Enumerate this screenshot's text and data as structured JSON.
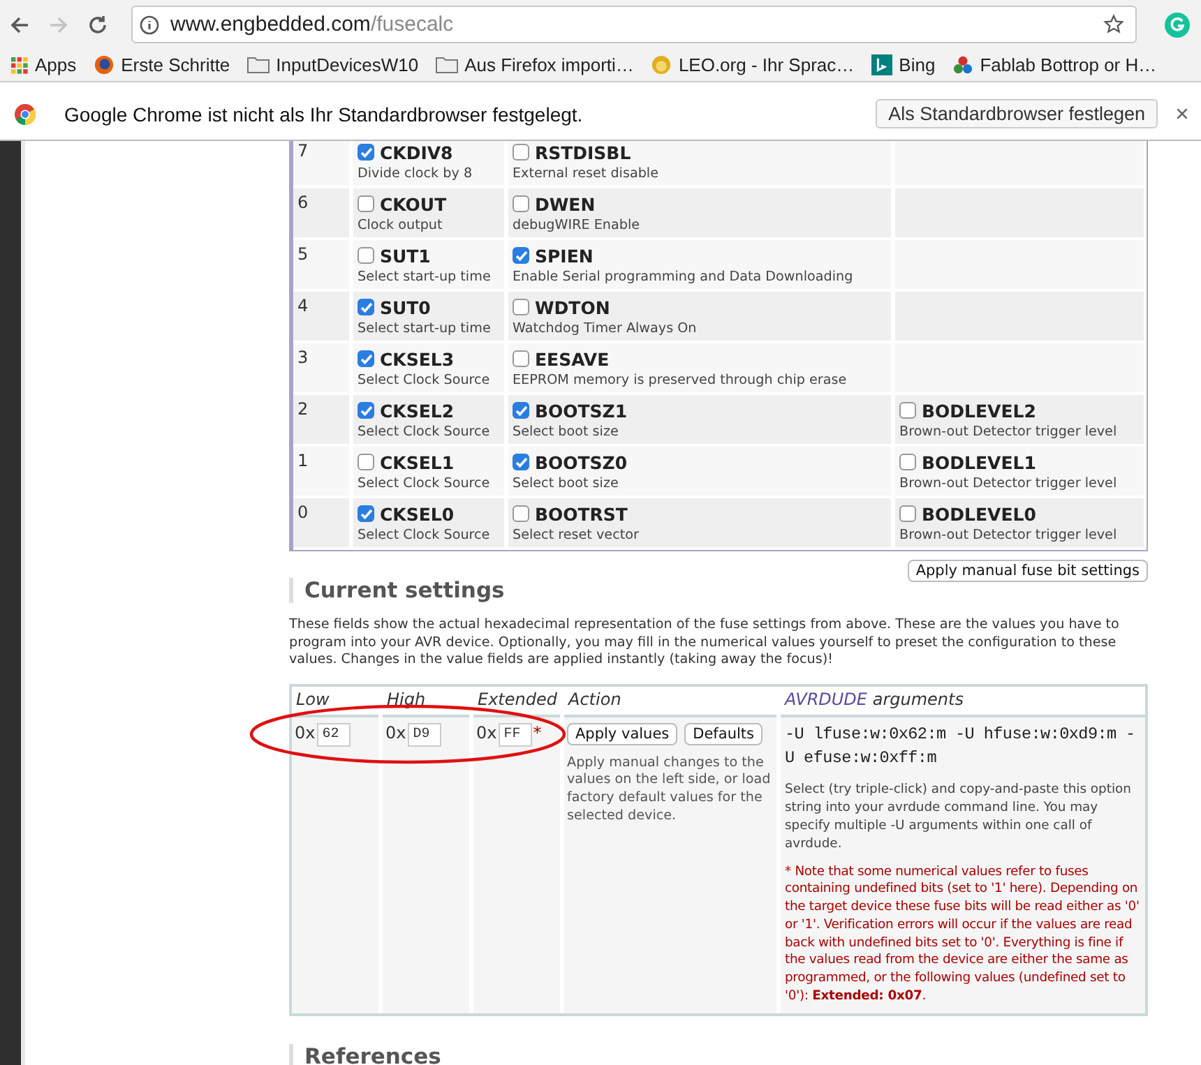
{
  "browser": {
    "url_host": "www.engbedded.com",
    "url_path": "/fusecalc",
    "bookmarks": [
      {
        "kind": "apps",
        "label": "Apps"
      },
      {
        "kind": "firefox",
        "label": "Erste Schritte"
      },
      {
        "kind": "folder",
        "label": "InputDevicesW10"
      },
      {
        "kind": "folder",
        "label": "Aus Firefox importi…"
      },
      {
        "kind": "leo",
        "label": "LEO.org - Ihr Sprac…"
      },
      {
        "kind": "bing",
        "label": "Bing"
      },
      {
        "kind": "fablab",
        "label": "Fablab Bottrop or H…"
      }
    ]
  },
  "infobar": {
    "message": "Google Chrome ist nicht als Ihr Standardbrowser festgelegt.",
    "button": "Als Standardbrowser festlegen"
  },
  "fuse_table": {
    "rows": [
      {
        "bit": "7",
        "fuses": [
          {
            "name": "CKDIV8",
            "checked": true,
            "description": "Divide clock by 8"
          },
          {
            "name": "RSTDISBL",
            "checked": false,
            "description": "External reset disable"
          }
        ]
      },
      {
        "bit": "6",
        "fuses": [
          {
            "name": "CKOUT",
            "checked": false,
            "description": "Clock output"
          },
          {
            "name": "DWEN",
            "checked": false,
            "description": "debugWIRE Enable"
          }
        ]
      },
      {
        "bit": "5",
        "fuses": [
          {
            "name": "SUT1",
            "checked": false,
            "description": "Select start-up time"
          },
          {
            "name": "SPIEN",
            "checked": true,
            "description": "Enable Serial programming and Data Downloading"
          }
        ]
      },
      {
        "bit": "4",
        "fuses": [
          {
            "name": "SUT0",
            "checked": true,
            "description": "Select start-up time"
          },
          {
            "name": "WDTON",
            "checked": false,
            "description": "Watchdog Timer Always On"
          }
        ]
      },
      {
        "bit": "3",
        "fuses": [
          {
            "name": "CKSEL3",
            "checked": true,
            "description": "Select Clock Source"
          },
          {
            "name": "EESAVE",
            "checked": false,
            "description": "EEPROM memory is preserved through chip erase"
          }
        ]
      },
      {
        "bit": "2",
        "fuses": [
          {
            "name": "CKSEL2",
            "checked": true,
            "description": "Select Clock Source"
          },
          {
            "name": "BOOTSZ1",
            "checked": true,
            "description": "Select boot size"
          },
          {
            "name": "BODLEVEL2",
            "checked": false,
            "description": "Brown-out Detector trigger level"
          }
        ]
      },
      {
        "bit": "1",
        "fuses": [
          {
            "name": "CKSEL1",
            "checked": false,
            "description": "Select Clock Source"
          },
          {
            "name": "BOOTSZ0",
            "checked": true,
            "description": "Select boot size"
          },
          {
            "name": "BODLEVEL1",
            "checked": false,
            "description": "Brown-out Detector trigger level"
          }
        ]
      },
      {
        "bit": "0",
        "fuses": [
          {
            "name": "CKSEL0",
            "checked": true,
            "description": "Select Clock Source"
          },
          {
            "name": "BOOTRST",
            "checked": false,
            "description": "Select reset vector"
          },
          {
            "name": "BODLEVEL0",
            "checked": false,
            "description": "Brown-out Detector trigger level"
          }
        ]
      }
    ],
    "apply_button": "Apply manual fuse bit settings"
  },
  "current_settings": {
    "heading": "Current settings",
    "intro": "These fields show the actual hexadecimal representation of the fuse settings from above. These are the values you have to program into your AVR device. Optionally, you may fill in the numerical values yourself to preset the configuration to these values. Changes in the value fields are applied instantly (taking away the focus)!",
    "fields": [
      {
        "label": "Low",
        "prefix": "0x",
        "value": "62"
      },
      {
        "label": "High",
        "prefix": "0x",
        "value": "D9"
      },
      {
        "label": "Extended",
        "prefix": "0x",
        "value": "FF",
        "mark": "*"
      }
    ],
    "action": {
      "label": "Action",
      "buttons": [
        "Apply values",
        "Defaults"
      ],
      "text": "Apply manual changes to the values on the left side, or load factory default values for the selected device."
    },
    "avrdude": {
      "name": "AVRDUDE",
      "label": "arguments",
      "command": "-U lfuse:w:0x62:m -U hfuse:w:0xd9:m -U efuse:w:0xff:m",
      "help": "Select (try triple-click) and copy-and-paste this option string into your avrdude command line. You may specify multiple -U arguments within one call of avrdude.",
      "note": "* Note that some numerical values refer to fuses containing undefined bits (set to '1' here). Depending on the target device these fuse bits will be read either as '0' or '1'. Verification errors will occur if the values are read back with undefined bits set to '0'. Everything is fine if the values read from the device are either the same as programmed, or the following values (undefined set to '0'): **Extended: 0x07**."
    }
  },
  "references": {
    "heading": "References"
  }
}
